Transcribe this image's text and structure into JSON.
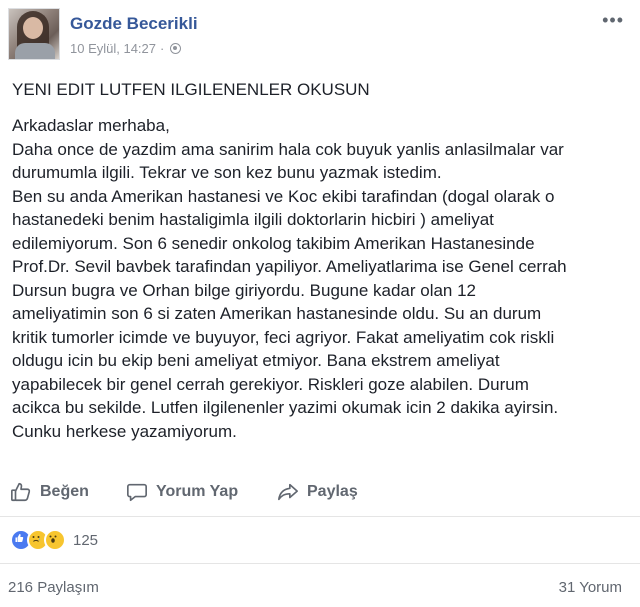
{
  "post": {
    "author": "Gozde Becerikli",
    "date": "10 Eylül, 14:27",
    "separator": "·",
    "more_menu": "•••",
    "headline": "YENI EDIT LUTFEN ILGILENENLER OKUSUN",
    "lines": [
      "Arkadaslar merhaba,",
      "Daha once de yazdim ama sanirim hala cok buyuk yanlis anlasilmalar var",
      "durumumla ilgili. Tekrar ve son kez bunu yazmak istedim.",
      "Ben su anda Amerikan hastanesi ve Koc ekibi tarafindan (dogal olarak o",
      "hastanedeki benim hastaligimla ilgili doktorlarin hicbiri ) ameliyat",
      "edilemiyorum. Son 6 senedir onkolog takibim Amerikan Hastanesinde",
      "Prof.Dr. Sevil bavbek tarafindan yapiliyor. Ameliyatlarima ise Genel cerrah",
      "Dursun bugra ve Orhan bilge giriyordu. Bugune kadar olan 12",
      "ameliyatimin son 6 si zaten Amerikan hastanesinde oldu. Su an durum",
      "kritik tumorler icimde ve buyuyor, feci agriyor. Fakat ameliyatim cok riskli",
      "oldugu icin bu ekip beni ameliyat etmiyor. Bana ekstrem ameliyat",
      "yapabilecek bir genel cerrah gerekiyor. Riskleri goze alabilen. Durum",
      "acikca bu sekilde. Lutfen ilgilenenler yazimi okumak icin 2 dakika ayirsin.",
      "Cunku herkese yazamiyorum."
    ]
  },
  "actions": {
    "like": "Beğen",
    "comment": "Yorum Yap",
    "share": "Paylaş"
  },
  "icons": {
    "like": "thumbs-up-icon",
    "comment": "speech-bubble-icon",
    "share": "share-arrow-icon",
    "privacy": "globe-icon"
  },
  "reactions": {
    "types": [
      "like",
      "sad",
      "wow"
    ],
    "count": "125"
  },
  "stats": {
    "shares": "216 Paylaşım",
    "comments": "31 Yorum"
  },
  "colors": {
    "author": "#365899",
    "text": "#1d2129",
    "muted": "#616770",
    "like_blue": "#4a7af0",
    "emoji_yellow": "#f7c52f"
  }
}
